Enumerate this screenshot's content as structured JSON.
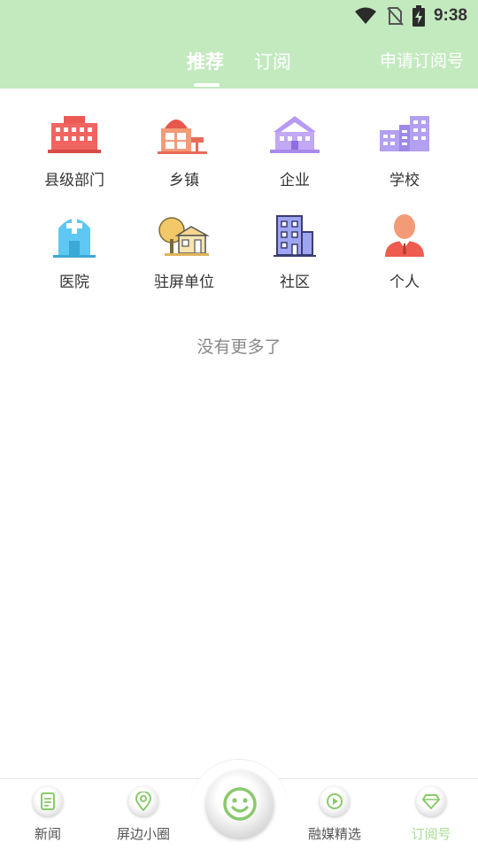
{
  "status_bar": {
    "time": "9:38",
    "icons": [
      "wifi-icon",
      "no-sim-icon",
      "battery-charging-icon"
    ]
  },
  "tabs": {
    "recommend": "推荐",
    "subscribe": "订阅",
    "apply": "申请订阅号"
  },
  "categories": [
    {
      "label": "县级部门",
      "icon": "government-building-icon"
    },
    {
      "label": "乡镇",
      "icon": "township-icon"
    },
    {
      "label": "企业",
      "icon": "enterprise-icon"
    },
    {
      "label": "学校",
      "icon": "school-icon"
    },
    {
      "label": "医院",
      "icon": "hospital-icon"
    },
    {
      "label": "驻屏单位",
      "icon": "stationed-unit-icon"
    },
    {
      "label": "社区",
      "icon": "community-icon"
    },
    {
      "label": "个人",
      "icon": "person-icon"
    }
  ],
  "empty_state": "没有更多了",
  "bottom_nav": {
    "news": "新闻",
    "nearby": "屏边小圈",
    "center": "smiley-icon",
    "media": "融媒精选",
    "subscription": "订阅号"
  },
  "colors": {
    "header_bg": "#c3eabf",
    "active_nav": "#a4dd90",
    "accent_green": "#8ac96c"
  }
}
